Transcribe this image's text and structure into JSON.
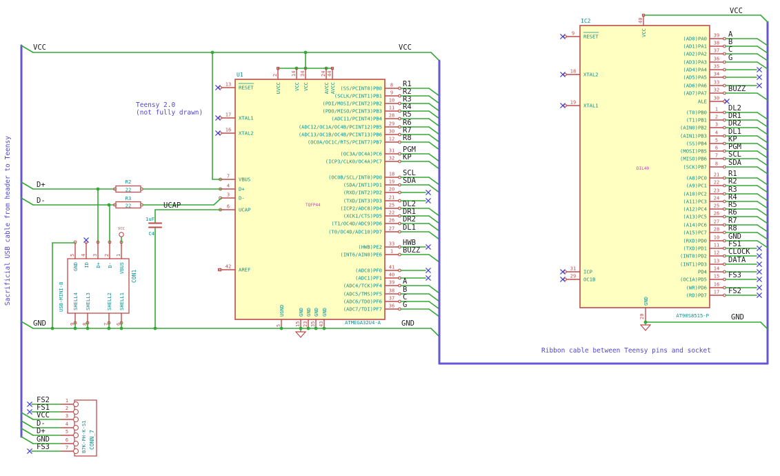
{
  "annotations": {
    "left_note": "Sacrificial USB cable from header to Teensy",
    "teensy_note_line1": "Teensy 2.0",
    "teensy_note_line2": "(not fully drawn)",
    "ribbon_note": "Ribbon cable between Teensy pins and socket"
  },
  "nets": {
    "vcc": "VCC",
    "gnd": "GND",
    "d_plus": "D+",
    "d_minus": "D-",
    "ucap": "UCAP"
  },
  "colors": {
    "wire": "#35a835",
    "bus": "#6557d4",
    "symbol": "#bf4a4a",
    "fill": "#ffffc2",
    "pin_name": "#0d8f8f",
    "pin_number": "#bf4a4a",
    "net_label": "#202020",
    "note": "#4f46d6",
    "noconnect": "#4744cf",
    "footprint": "#bf40bf"
  },
  "u1": {
    "ref": "U1",
    "value": "ATMEGA32U4-A",
    "footprint": "TQFP44",
    "left_pins": [
      {
        "name": "RESET",
        "num": "13",
        "term": "nc"
      },
      {
        "name": "XTAL1",
        "num": "17",
        "term": "nc"
      },
      {
        "name": "XTAL2",
        "num": "16",
        "term": "nc"
      },
      {
        "name": "VBUS",
        "num": "7",
        "term": "wire"
      },
      {
        "name": "D+",
        "num": "4",
        "term": "wire"
      },
      {
        "name": "D-",
        "num": "3",
        "term": "wire"
      },
      {
        "name": "UCAP",
        "num": "6",
        "term": "wire"
      },
      {
        "name": "AREF",
        "num": "42",
        "term": "open"
      }
    ],
    "top_pins": [
      {
        "name": "UVCC",
        "num": "2"
      },
      {
        "name": "VCC",
        "num": "14"
      },
      {
        "name": "VCC",
        "num": "34"
      },
      {
        "name": "AVCC",
        "num": "24"
      },
      {
        "name": "AVCC",
        "num": "44"
      }
    ],
    "bottom_pins": [
      {
        "name": "UGND",
        "num": "5"
      },
      {
        "name": "GND",
        "num": "15"
      },
      {
        "name": "GND",
        "num": "23"
      },
      {
        "name": "GND",
        "num": "35"
      },
      {
        "name": "GND",
        "num": "43"
      }
    ],
    "right_pins": [
      {
        "name": "(SS/PCINT0)PB0",
        "num": "8",
        "label": "R1",
        "term": "bus"
      },
      {
        "name": "(SCLK/PCINT1)PB1",
        "num": "9",
        "label": "R2",
        "term": "bus"
      },
      {
        "name": "(PDI/MOSI/PCINT2)PB2",
        "num": "10",
        "label": "R3",
        "term": "bus"
      },
      {
        "name": "(PDO/MISO/PCINT3)PB3",
        "num": "11",
        "label": "R4",
        "term": "bus"
      },
      {
        "name": "(ADC11/PCINT4)PB4",
        "num": "28",
        "label": "R5",
        "term": "bus"
      },
      {
        "name": "(ADC12/OC1A/OC4B/PCINT12)PB5",
        "num": "29",
        "label": "R6",
        "term": "bus"
      },
      {
        "name": "(ADC13/OC1B/OC4B/PCINT13)PB6",
        "num": "30",
        "label": "R7",
        "term": "bus"
      },
      {
        "name": "(OC0A/OC1C/RTS/PCINT7)PB7",
        "num": "12",
        "label": "R8",
        "term": "bus"
      },
      {
        "name": "(OC3A/OC4A)PC6",
        "num": "31",
        "label": "PGM",
        "term": "bus"
      },
      {
        "name": "(ICP3/CLK0/OC4A)PC7",
        "num": "32",
        "label": "KP",
        "term": "bus"
      },
      {
        "name": "(OC0B/SCL/INT0)PD0",
        "num": "18",
        "label": "SCL",
        "term": "bus"
      },
      {
        "name": "(SDA/INT1)PD1",
        "num": "19",
        "label": "SDA",
        "term": "bus"
      },
      {
        "name": "(RXD/INT2)PD2",
        "num": "20",
        "label": "",
        "term": "nc"
      },
      {
        "name": "(TXD/INT3)PD3",
        "num": "21",
        "label": "",
        "term": "nc"
      },
      {
        "name": "(ICP2/ADC8)PD4",
        "num": "25",
        "label": "DL2",
        "term": "bus"
      },
      {
        "name": "(XCK1/CTS)PD5",
        "num": "22",
        "label": "DR1",
        "term": "bus"
      },
      {
        "name": "(T1/OC4D/ADC9)PD6",
        "num": "26",
        "label": "DR2",
        "term": "bus"
      },
      {
        "name": "(T0/OC4D/ADC10)PD7",
        "num": "27",
        "label": "DL1",
        "term": "bus"
      },
      {
        "name": "(HWB)PE2",
        "num": "33",
        "label": "HWB",
        "term": "nc"
      },
      {
        "name": "(INT6/AIN0)PE6",
        "num": "1",
        "label": "BUZZ",
        "term": "bus"
      },
      {
        "name": "(ADC0)PF0",
        "num": "41",
        "label": "",
        "term": "nc"
      },
      {
        "name": "(ADC1)PF1",
        "num": "40",
        "label": "",
        "term": "nc"
      },
      {
        "name": "(ADC4/TCK)PF4",
        "num": "39",
        "label": "A",
        "term": "bus"
      },
      {
        "name": "(ADC5/TMS)PF5",
        "num": "38",
        "label": "B",
        "term": "bus"
      },
      {
        "name": "(ADC6/TDO)PF6",
        "num": "37",
        "label": "C",
        "term": "bus"
      },
      {
        "name": "(ADC7/TDI)PF7",
        "num": "36",
        "label": "G",
        "term": "bus"
      }
    ]
  },
  "ic2": {
    "ref": "IC2",
    "value": "AT90S8515-P",
    "footprint": "DIL40",
    "top_pin": {
      "name": "VCC",
      "num": "40"
    },
    "bottom_pin": {
      "name": "GND",
      "num": "20"
    },
    "left_pins": [
      {
        "name": "RESET",
        "num": "9",
        "term": "nc"
      },
      {
        "name": "XTAL2",
        "num": "18",
        "term": "nc"
      },
      {
        "name": "XTAL1",
        "num": "19",
        "term": "nc"
      },
      {
        "name": "ICP",
        "num": "31",
        "term": "nc"
      },
      {
        "name": "OC1B",
        "num": "29",
        "term": "nc"
      }
    ],
    "right_pins": [
      {
        "name": "(AD0)PA0",
        "num": "39",
        "label": "A",
        "term": "bus"
      },
      {
        "name": "(AD1)PA1",
        "num": "38",
        "label": "B",
        "term": "bus"
      },
      {
        "name": "(AD2)PA2",
        "num": "37",
        "label": "C",
        "term": "bus"
      },
      {
        "name": "(AD3)PA3",
        "num": "36",
        "label": "G",
        "term": "bus"
      },
      {
        "name": "(AD4)PA4",
        "num": "35",
        "label": "",
        "term": "nc"
      },
      {
        "name": "(AD5)PA5",
        "num": "34",
        "label": "",
        "term": "nc"
      },
      {
        "name": "(AD6)PA6",
        "num": "33",
        "label": "",
        "term": "nc"
      },
      {
        "name": "(AD7)PA7",
        "num": "32",
        "label": "BUZZ",
        "term": "bus"
      },
      {
        "name": "ALE",
        "num": "30",
        "label": "",
        "term": "nc-stub"
      },
      {
        "name": "(T0)PB0",
        "num": "1",
        "label": "DL2",
        "term": "bus"
      },
      {
        "name": "(T1)PB1",
        "num": "2",
        "label": "DR1",
        "term": "bus"
      },
      {
        "name": "(AIN0)PB2",
        "num": "3",
        "label": "DR2",
        "term": "bus"
      },
      {
        "name": "(AIN1)PB3",
        "num": "4",
        "label": "DL1",
        "term": "bus"
      },
      {
        "name": "(SS)PB4",
        "num": "5",
        "label": "KP",
        "term": "bus"
      },
      {
        "name": "(MOSI)PB5",
        "num": "6",
        "label": "PGM",
        "term": "bus"
      },
      {
        "name": "(MISO)PB6",
        "num": "7",
        "label": "SCL",
        "term": "bus"
      },
      {
        "name": "(SCK)PB7",
        "num": "8",
        "label": "SDA",
        "term": "bus"
      },
      {
        "name": "(A8)PC0",
        "num": "21",
        "label": "R1",
        "term": "bus"
      },
      {
        "name": "(A9)PC1",
        "num": "22",
        "label": "R2",
        "term": "bus"
      },
      {
        "name": "(A10)PC2",
        "num": "23",
        "label": "R3",
        "term": "bus"
      },
      {
        "name": "(A11)PC3",
        "num": "24",
        "label": "R4",
        "term": "bus"
      },
      {
        "name": "(A12)PC4",
        "num": "25",
        "label": "R5",
        "term": "bus"
      },
      {
        "name": "(A13)PC5",
        "num": "26",
        "label": "R6",
        "term": "bus"
      },
      {
        "name": "(A14)PC6",
        "num": "27",
        "label": "R7",
        "term": "bus"
      },
      {
        "name": "(A15)PC7",
        "num": "28",
        "label": "R8",
        "term": "bus"
      },
      {
        "name": "(RXD)PD0",
        "num": "10",
        "label": "GND",
        "term": "bus"
      },
      {
        "name": "(TXD)PD1",
        "num": "11",
        "label": "FS1",
        "term": "nc"
      },
      {
        "name": "(INT0)PD2",
        "num": "12",
        "label": "CLOCK",
        "term": "nc"
      },
      {
        "name": "(INT1)PD3",
        "num": "13",
        "label": "DATA",
        "term": "nc"
      },
      {
        "name": "PD4",
        "num": "14",
        "label": "",
        "term": "nc"
      },
      {
        "name": "(OC1A)PD5",
        "num": "15",
        "label": "FS3",
        "term": "nc"
      },
      {
        "name": "(WR)PD6",
        "num": "16",
        "label": "",
        "term": "nc"
      },
      {
        "name": "(RD)PD7",
        "num": "17",
        "label": "FS2",
        "term": "nc"
      }
    ]
  },
  "con1": {
    "ref": "CON1",
    "value": "USB-MINI-B",
    "top_pins": [
      {
        "name": "GND",
        "num": "5"
      },
      {
        "name": "ID",
        "num": "4"
      },
      {
        "name": "D+",
        "num": "3"
      },
      {
        "name": "D-",
        "num": "2"
      },
      {
        "name": "VBUS",
        "num": "1"
      }
    ],
    "bottom_pins": [
      {
        "name": "SHELL4",
        "num": "9"
      },
      {
        "name": "SHELL3",
        "num": "8"
      },
      {
        "name": "SHELL2",
        "num": "7"
      },
      {
        "name": "SHELL1",
        "num": "6"
      }
    ]
  },
  "conn7": {
    "ref": "CONN_7",
    "value": "B7K-PH-K-S1",
    "pins": [
      {
        "label": "FS2",
        "num": "1",
        "term": "nc"
      },
      {
        "label": "FS1",
        "num": "2",
        "term": "nc"
      },
      {
        "label": "VCC",
        "num": "3",
        "term": "bus"
      },
      {
        "label": "D-",
        "num": "4",
        "term": "bus"
      },
      {
        "label": "D+",
        "num": "5",
        "term": "bus"
      },
      {
        "label": "GND",
        "num": "6",
        "term": "bus"
      },
      {
        "label": "FS3",
        "num": "7",
        "term": "nc"
      }
    ]
  },
  "r2": {
    "ref": "R2",
    "value": "22"
  },
  "r3": {
    "ref": "R3",
    "value": "22"
  },
  "c4": {
    "ref": "C4",
    "value": "1uF"
  }
}
